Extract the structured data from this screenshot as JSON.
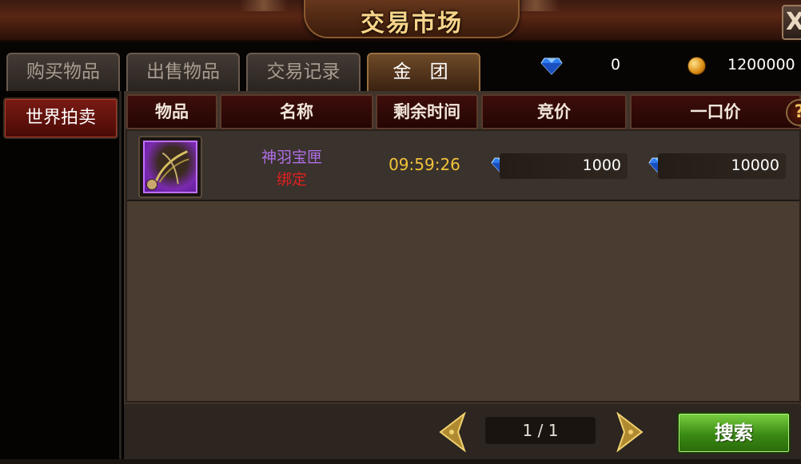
{
  "window": {
    "title": "交易市场",
    "close_label": "X"
  },
  "tabs": [
    {
      "label": "购买物品",
      "active": false
    },
    {
      "label": "出售物品",
      "active": false
    },
    {
      "label": "交易记录",
      "active": false
    },
    {
      "label": "金 团",
      "active": true
    }
  ],
  "currency": {
    "diamonds": "0",
    "gold": "1200000",
    "diamond_icon": "diamond-icon",
    "gold_icon": "gold-coin-icon"
  },
  "sidebar": {
    "items": [
      {
        "label": "世界拍卖",
        "active": true
      }
    ]
  },
  "table": {
    "headers": [
      "物品",
      "名称",
      "剩余时间",
      "竞价",
      "一口价"
    ],
    "help_label": "?",
    "rows": [
      {
        "name": "神羽宝匣",
        "bind_status": "绑定",
        "remaining": "09:59:26",
        "bid": "1000",
        "buyout": "10000",
        "icon": "treasure-box-icon"
      }
    ]
  },
  "pagination": {
    "label": "1 / 1"
  },
  "search": {
    "label": "搜索"
  },
  "colors": {
    "item_name": "#b070e8",
    "bound": "#e02020",
    "time": "#f2c23a",
    "search_button": "#3a8a14"
  }
}
